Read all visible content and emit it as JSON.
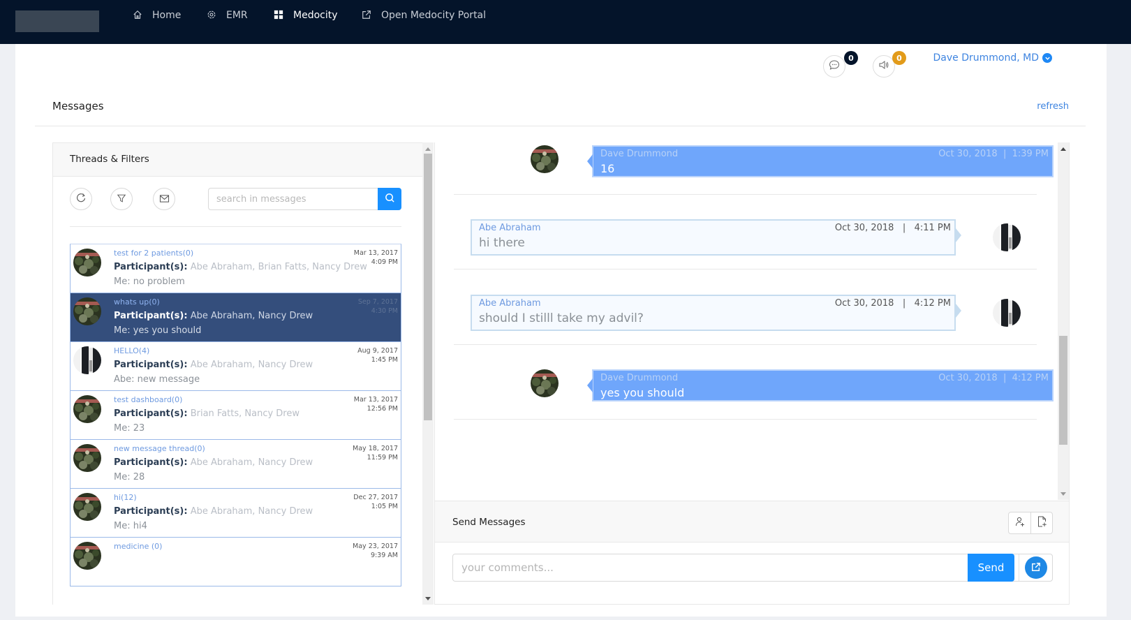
{
  "nav": {
    "items": [
      {
        "label": "Home",
        "icon": "home-icon"
      },
      {
        "label": "EMR",
        "icon": "gear-icon"
      },
      {
        "label": "Medocity",
        "icon": "grid-icon",
        "active": true
      },
      {
        "label": "Open Medocity Portal",
        "icon": "external-link-icon"
      }
    ]
  },
  "header": {
    "messages_badge": "0",
    "notifications_badge": "0",
    "user_name": "Dave Drummond, MD",
    "colors": {
      "messages_badge": "#04142a",
      "notifications_badge": "#e29b1a",
      "accent": "#1890ff"
    }
  },
  "page": {
    "title": "Messages",
    "refresh_label": "refresh"
  },
  "threads_panel": {
    "title": "Threads & Filters",
    "search_placeholder": "search in messages",
    "participants_label": "Participant(s):",
    "threads": [
      {
        "title": "test for 2 patients(0)",
        "participants": "Abe Abraham, Brian Fatts, Nancy Drew",
        "last": "Me: no problem",
        "date": "Mar 13, 2017",
        "time": "4:09 PM",
        "avatar": "camo",
        "selected": false
      },
      {
        "title": "whats up(0)",
        "participants": "Abe Abraham, Nancy Drew",
        "last": "Me: yes you should",
        "date": "Sep 7, 2017",
        "time": "4:30 PM",
        "avatar": "camo",
        "selected": true
      },
      {
        "title": "HELLO(4)",
        "participants": "Abe Abraham, Nancy Drew",
        "last": "Abe: new message",
        "date": "Aug 9, 2017",
        "time": "1:45 PM",
        "avatar": "bw",
        "selected": false
      },
      {
        "title": "test dashboard(0)",
        "participants": "Brian Fatts, Nancy Drew",
        "last": "Me: 23",
        "date": "Mar 13, 2017",
        "time": "12:56 PM",
        "avatar": "camo",
        "selected": false
      },
      {
        "title": "new message thread(0)",
        "participants": "Abe Abraham, Nancy Drew",
        "last": "Me: 28",
        "date": "May 18, 2017",
        "time": "11:59 PM",
        "avatar": "camo",
        "selected": false
      },
      {
        "title": "hi(12)",
        "participants": "Abe Abraham, Nancy Drew",
        "last": "Me: hi4",
        "date": "Dec 27, 2017",
        "time": "1:05 PM",
        "avatar": "camo",
        "selected": false
      },
      {
        "title": "medicine (0)",
        "participants": "",
        "last": "",
        "date": "May 23, 2017",
        "time": "9:39 AM",
        "avatar": "camo",
        "selected": false
      }
    ]
  },
  "chat": {
    "messages": [
      {
        "sender": "Dave Drummond",
        "date": "Oct 30, 2018",
        "time": "1:39 PM",
        "text": "16",
        "mine": true
      },
      {
        "sender": "Abe Abraham",
        "date": "Oct 30, 2018",
        "time": "4:11 PM",
        "text": "hi there",
        "mine": false
      },
      {
        "sender": "Abe Abraham",
        "date": "Oct 30, 2018",
        "time": "4:12 PM",
        "text": "should I stilll take my advil?",
        "mine": false
      },
      {
        "sender": "Dave Drummond",
        "date": "Oct 30, 2018",
        "time": "4:12 PM",
        "text": "yes you should",
        "mine": true
      }
    ],
    "send_title": "Send Messages",
    "compose_placeholder": "your comments...",
    "send_label": "Send"
  }
}
